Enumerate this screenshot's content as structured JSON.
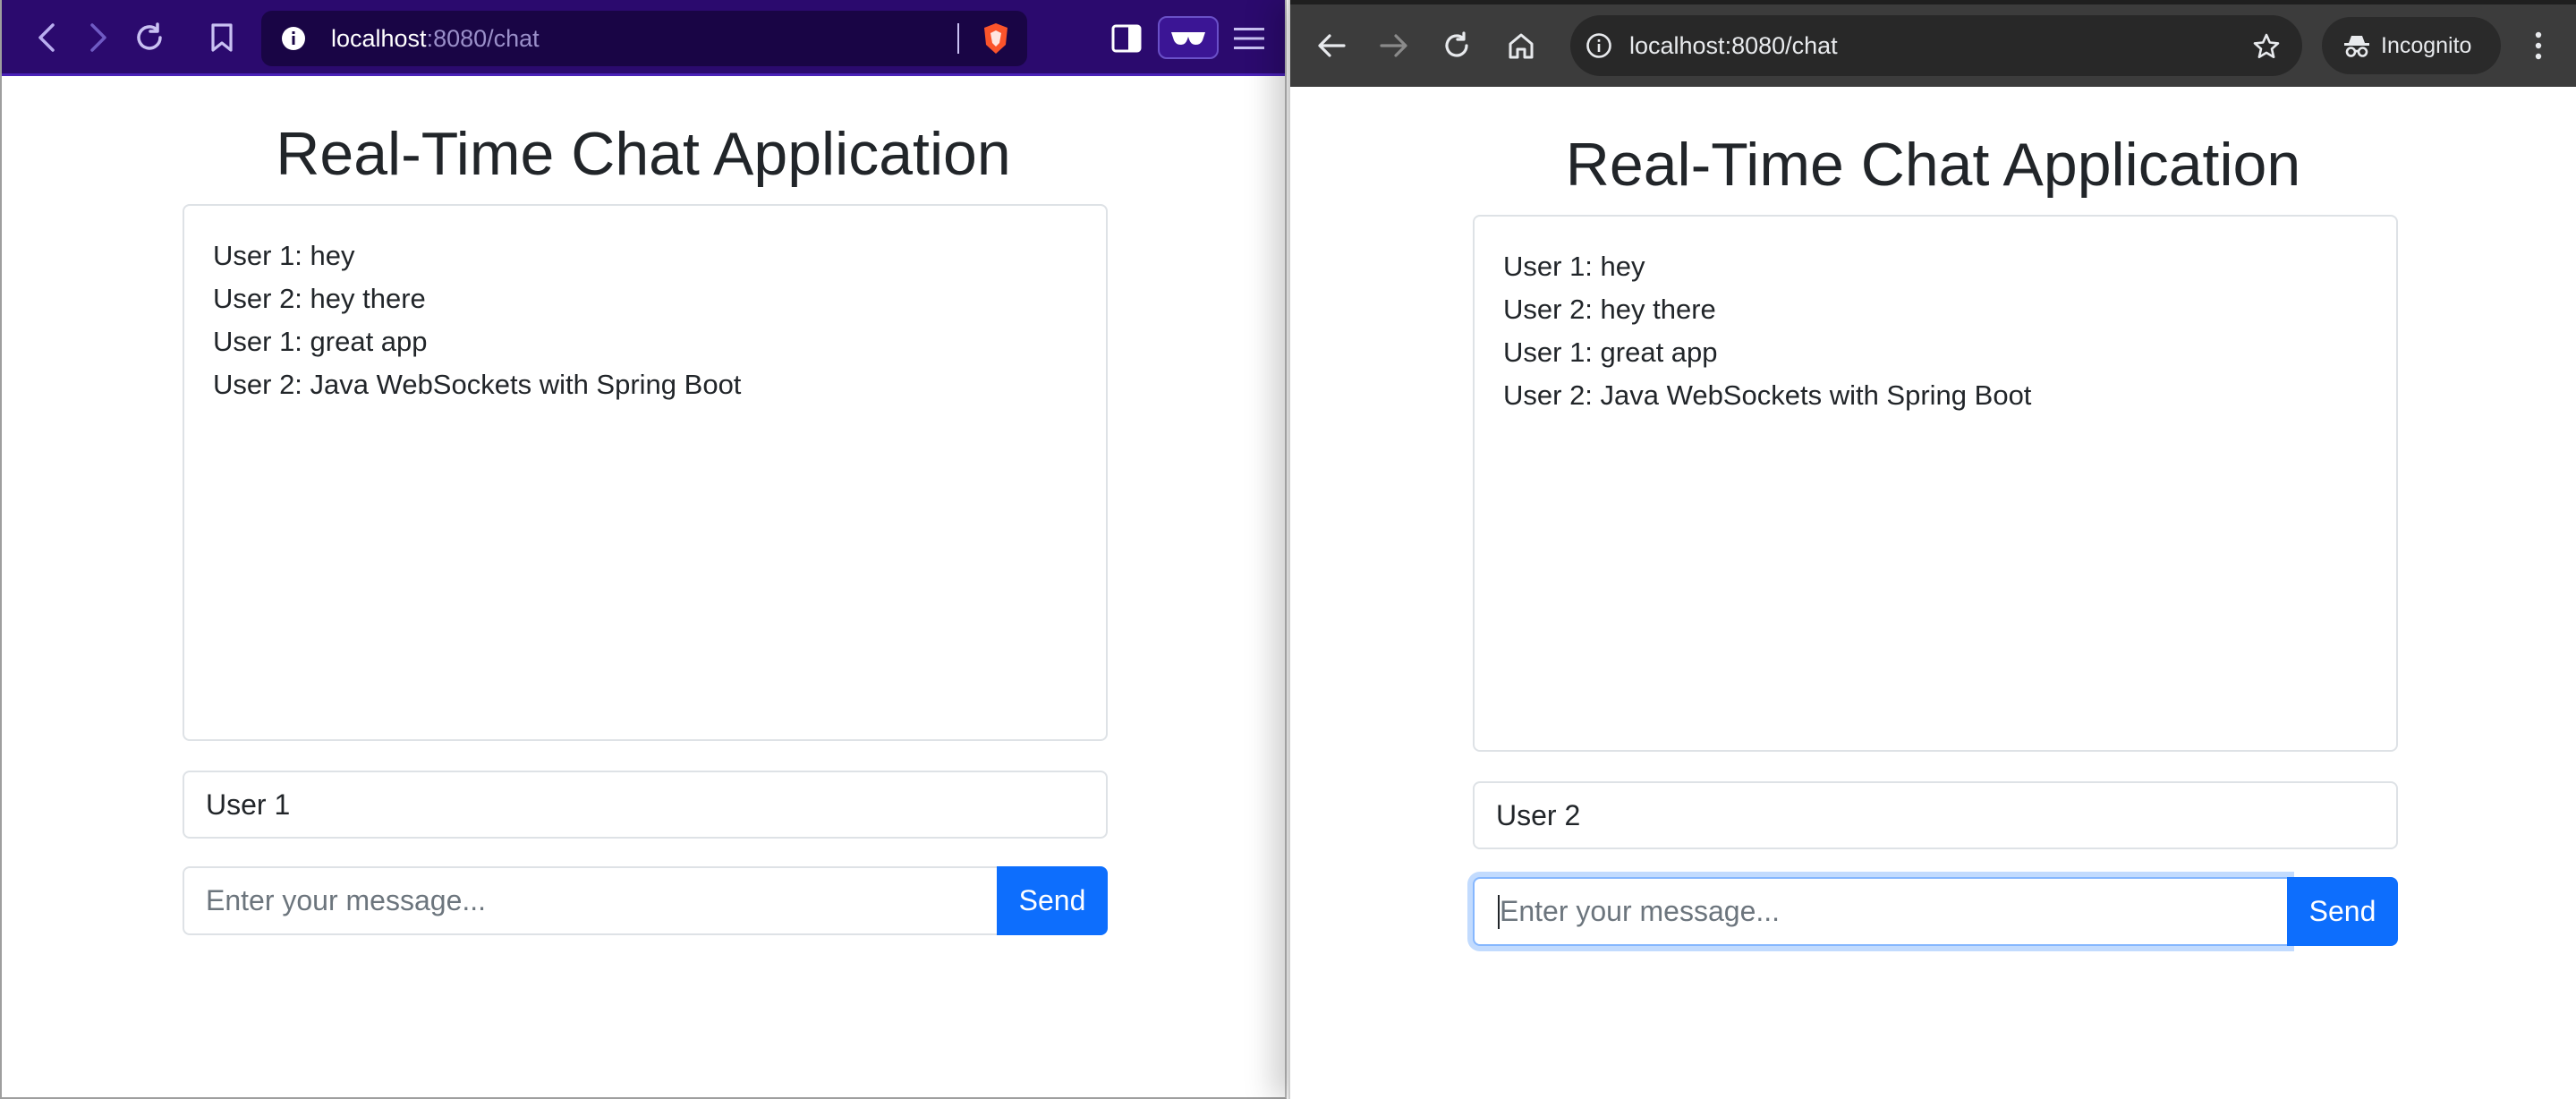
{
  "left_window": {
    "browser": {
      "url_host": "localhost",
      "url_path": ":8080/chat",
      "accent": "#2b0a6e"
    },
    "page": {
      "title": "Real-Time Chat Application",
      "messages": [
        "User 1: hey",
        "User 2: hey there",
        "User 1: great app",
        "User 2: Java WebSockets with Spring Boot"
      ],
      "username_value": "User 1",
      "message_placeholder": "Enter your message...",
      "send_label": "Send"
    }
  },
  "right_window": {
    "browser": {
      "url": "localhost:8080/chat",
      "incognito_label": "Incognito",
      "accent": "#3c3c3c"
    },
    "page": {
      "title": "Real-Time Chat Application",
      "messages": [
        "User 1: hey",
        "User 2: hey there",
        "User 1: great app",
        "User 2: Java WebSockets with Spring Boot"
      ],
      "username_value": "User 2",
      "message_placeholder": "Enter your message...",
      "send_label": "Send"
    }
  },
  "colors": {
    "primary_button": "#0d6efd",
    "border": "#dee2e6",
    "text": "#212529"
  }
}
